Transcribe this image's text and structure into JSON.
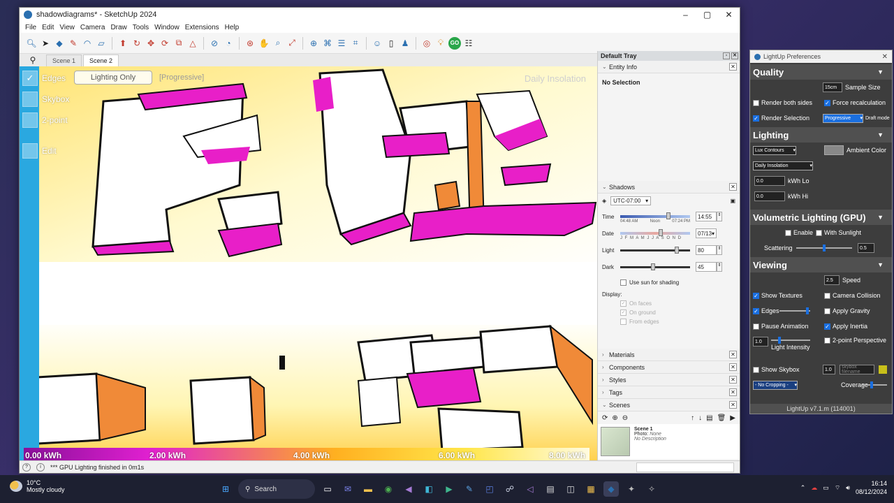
{
  "window": {
    "title": "shadowdiagrams* - SketchUp 2024",
    "controls": [
      "–",
      "▢",
      "✕"
    ]
  },
  "menu": [
    "File",
    "Edit",
    "View",
    "Camera",
    "Draw",
    "Tools",
    "Window",
    "Extensions",
    "Help"
  ],
  "scene_tabs": [
    "Scene 1",
    "Scene 2"
  ],
  "viewport": {
    "toggles": [
      "Edges",
      "Skybox",
      "2-point",
      "Edit"
    ],
    "lighting_mode": "Lighting Only",
    "render_mode": "[Progressive]",
    "overlay_title": "Daily Insolation",
    "legend": [
      "0.00 kWh",
      "2.00 kWh",
      "4.00 kWh",
      "6.00 kWh",
      "8.00 kWh"
    ]
  },
  "status": {
    "text": "*** GPU Lighting finished in 0m1s"
  },
  "tray": {
    "title": "Default Tray",
    "entity_info": {
      "label": "Entity Info",
      "value": "No Selection"
    },
    "shadows": {
      "label": "Shadows",
      "timezone": "UTC-07:00",
      "time_label": "Time",
      "sunrise": "04:48 AM",
      "noon": "Noon",
      "sunset": "07:24 PM",
      "time_value": "14:55",
      "date_label": "Date",
      "months": "J F M A M J J A S O N D",
      "date_value": "07/13",
      "light_label": "Light",
      "light_value": "80",
      "dark_label": "Dark",
      "dark_value": "45",
      "use_sun": "Use sun for shading",
      "display_label": "Display:",
      "on_faces": "On faces",
      "on_ground": "On ground",
      "from_edges": "From edges"
    },
    "sections": [
      "Materials",
      "Components",
      "Styles",
      "Tags",
      "Scenes"
    ],
    "scene_card": {
      "name": "Scene 1",
      "photo_label": "Photo:",
      "photo": "None",
      "description": "No Description"
    }
  },
  "lightup": {
    "title": "LightUp Preferences",
    "quality": {
      "label": "Quality",
      "sample_size_value": "15cm",
      "sample_size_label": "Sample Size",
      "render_both_sides": "Render both sides",
      "force_recalc": "Force recalculation",
      "render_selection": "Render Selection",
      "mode": "Progressive",
      "draft_mode": "Draft mode"
    },
    "lighting": {
      "label": "Lighting",
      "contour_mode": "Lux Contours",
      "ambient_label": "Ambient Color",
      "analysis": "Daily Insolation",
      "kwh_lo_value": "0.0",
      "kwh_lo_label": "kWh Lo",
      "kwh_hi_value": "0.0",
      "kwh_hi_label": "kWh Hi"
    },
    "volumetric": {
      "label": "Volumetric Lighting (GPU)",
      "enable": "Enable",
      "with_sunlight": "With Sunlight",
      "scattering_label": "Scattering",
      "scattering_value": "0.5"
    },
    "viewing": {
      "label": "Viewing",
      "speed_value": "2.5",
      "speed_label": "Speed",
      "show_textures": "Show Textures",
      "camera_collision": "Camera Collision",
      "edges": "Edges",
      "apply_gravity": "Apply Gravity",
      "pause_animation": "Pause Animation",
      "apply_inertia": "Apply Inertia",
      "light_intensity_value": "1.0",
      "light_intensity_label": "Light Intensity",
      "two_point": "2-point Perspective",
      "show_skybox": "Show Skybox",
      "skybox_value": "1.0",
      "skybox_file": "skybox filename",
      "cropping": "- No Cropping -",
      "coverage_label": "Coverage"
    },
    "footer": "LightUp v7.1.m (114001)"
  },
  "taskbar": {
    "temp": "10°C",
    "weather": "Mostly cloudy",
    "search": "Search",
    "time": "16:14",
    "date": "08/12/2024"
  }
}
